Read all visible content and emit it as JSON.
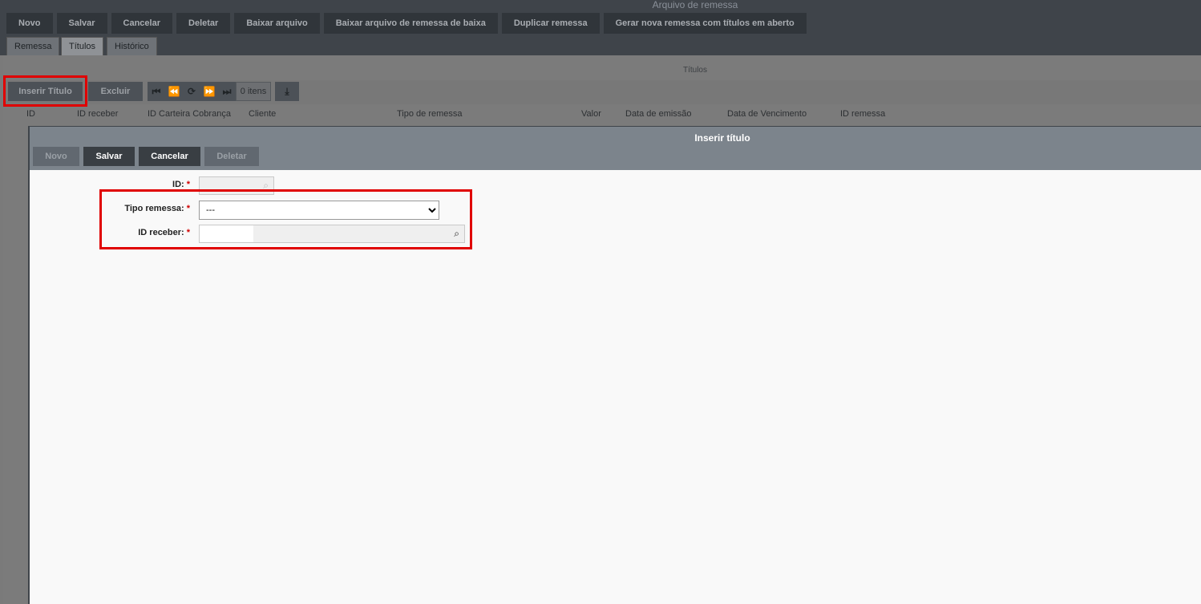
{
  "app": {
    "title": "Arquivo de remessa",
    "toolbar": [
      "Novo",
      "Salvar",
      "Cancelar",
      "Deletar",
      "Baixar arquivo",
      "Baixar arquivo de remessa de baixa",
      "Duplicar remessa",
      "Gerar nova remessa com títulos em aberto"
    ],
    "tabs": [
      "Remessa",
      "Títulos",
      "Histórico"
    ],
    "active_tab": "Títulos"
  },
  "titulos": {
    "section_title": "Títulos",
    "insert_button": "Inserir Título",
    "delete_button": "Excluir",
    "pager": {
      "icons": [
        "first-page-icon",
        "previous-page-icon",
        "refresh-icon",
        "next-page-icon",
        "last-page-icon"
      ],
      "count": "0 itens"
    },
    "download_icon": "download-icon",
    "columns": [
      "ID",
      "ID receber",
      "ID Carteira Cobrança",
      "Cliente",
      "Tipo de remessa",
      "Valor",
      "Data de emissão",
      "Data de Vencimento",
      "ID remessa"
    ]
  },
  "modal": {
    "title": "Inserir título",
    "buttons": {
      "novo": "Novo",
      "salvar": "Salvar",
      "cancelar": "Cancelar",
      "deletar": "Deletar"
    },
    "fields": {
      "id_label": "ID:",
      "tipo_label": "Tipo remessa:",
      "tipo_value": "---",
      "receber_label": "ID receber:",
      "required_mark": "*"
    }
  },
  "colors": {
    "highlight": "#e00000",
    "modal_header": "#7c848c",
    "dark_button": "#393e43"
  }
}
